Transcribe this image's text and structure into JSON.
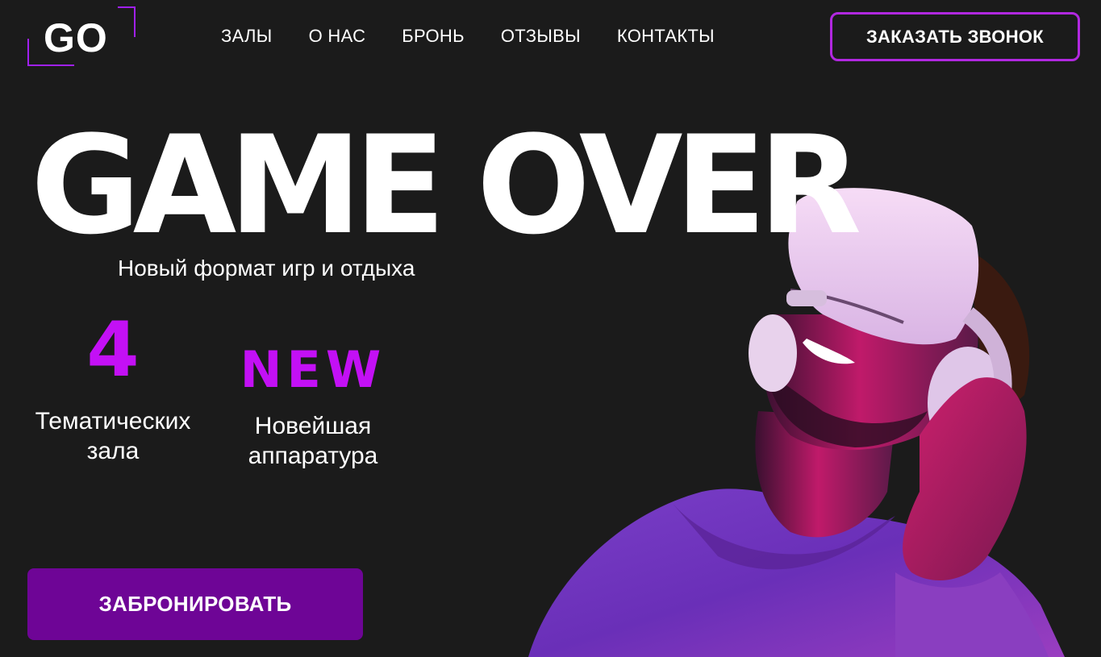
{
  "header": {
    "logo_text": "GO",
    "nav": [
      {
        "label": "ЗАЛЫ"
      },
      {
        "label": "О НАС"
      },
      {
        "label": "БРОНЬ"
      },
      {
        "label": "ОТЗЫВЫ"
      },
      {
        "label": "КОНТАКТЫ"
      }
    ],
    "call_button": "ЗАКАЗАТЬ ЗВОНОК"
  },
  "hero": {
    "title": "GAME OVER",
    "subtitle": "Новый формат игр и отдыха",
    "stats": [
      {
        "value": "4",
        "label_line1": "Тематических",
        "label_line2": "зала"
      },
      {
        "value": "NEW",
        "label_line1": "Новейшая",
        "label_line2": "аппаратура"
      }
    ],
    "book_button": "ЗАБРОНИРОВАТЬ",
    "photo": "man-wearing-vr-headset-and-headphones"
  },
  "colors": {
    "background": "#1b1b1b",
    "accent": "#c310f5",
    "button_fill": "#6e0596",
    "button_border": "#b128e0",
    "text": "#ffffff"
  }
}
